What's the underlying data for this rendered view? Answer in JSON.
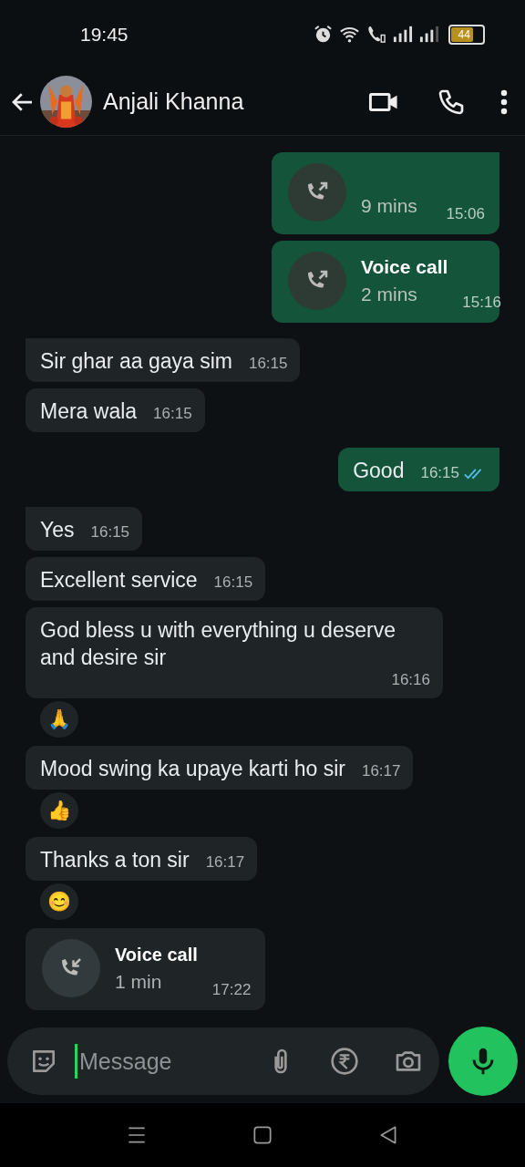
{
  "status_bar": {
    "time": "19:45",
    "battery": "44"
  },
  "header": {
    "contact_name": "Anjali Khanna"
  },
  "messages": [
    {
      "kind": "call",
      "outgoing": true,
      "duration": "9 mins",
      "time": "15:06"
    },
    {
      "kind": "call",
      "outgoing": true,
      "title": "Voice call",
      "duration": "2 mins",
      "time": "15:16"
    },
    {
      "kind": "text",
      "outgoing": false,
      "text": "Sir ghar aa gaya sim",
      "time": "16:15"
    },
    {
      "kind": "text",
      "outgoing": false,
      "text": "Mera wala",
      "time": "16:15"
    },
    {
      "kind": "text",
      "outgoing": true,
      "text": "Good",
      "time": "16:15",
      "read": true
    },
    {
      "kind": "text",
      "outgoing": false,
      "text": "Yes",
      "time": "16:15"
    },
    {
      "kind": "text",
      "outgoing": false,
      "text": "Excellent service",
      "time": "16:15"
    },
    {
      "kind": "text",
      "outgoing": false,
      "text": "God bless u with everything u deserve and desire sir",
      "time": "16:16",
      "reaction": "🙏"
    },
    {
      "kind": "text",
      "outgoing": false,
      "text": "Mood swing ka upaye karti ho sir",
      "time": "16:17",
      "reaction": "👍"
    },
    {
      "kind": "text",
      "outgoing": false,
      "text": "Thanks a ton sir",
      "time": "16:17",
      "reaction": "😊"
    },
    {
      "kind": "call",
      "outgoing": false,
      "title": "Voice call",
      "duration": "1 min",
      "time": "17:22"
    }
  ],
  "composer": {
    "placeholder": "Message"
  }
}
